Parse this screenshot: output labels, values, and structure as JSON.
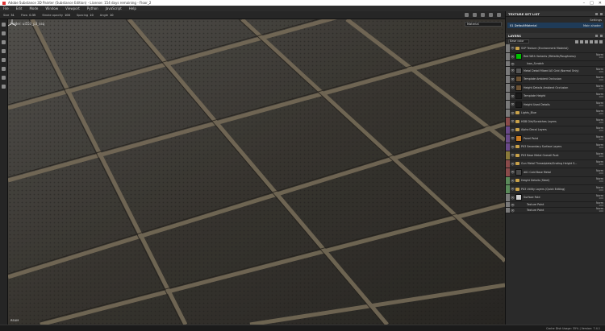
{
  "titlebar": {
    "text": "Adobe Substance 3D Painter (Substance Edition) - License: 154 days remaining - Floor_2"
  },
  "menubar": [
    "File",
    "Edit",
    "Mode",
    "Window",
    "Viewport",
    "Python",
    "JavaScript",
    "Help"
  ],
  "toolbar": {
    "items": [
      {
        "label": "Size",
        "value": "31"
      },
      {
        "label": "Flow",
        "value": "0.35"
      },
      {
        "label": "Stroke opacity",
        "value": "100"
      },
      {
        "label": "Spacing",
        "value": "10"
      },
      {
        "label": "Angle",
        "value": "10"
      }
    ]
  },
  "viewport": {
    "label": "Folder: ui553_p3_ssq",
    "material_select": "Material",
    "bottom_label": "REAM"
  },
  "statusbar": {
    "text": "Cache Disk Usage: 35% | Version: 7.4.1"
  },
  "texture_set_list": {
    "title": "TEXTURE SET LIST",
    "settings_label": "Settings",
    "set_name": "01 DefaultMaterial",
    "shader": "Main shader"
  },
  "layers": {
    "title": "LAYERS",
    "blend_select": "Base color",
    "items": [
      {
        "name": "SVP Texture (Environment Material)",
        "kind": "folder",
        "color": "#7a7a7a",
        "blend": "",
        "opacity": ""
      },
      {
        "name": "Red With Variants (Metallic/Roughness)",
        "kind": "fill",
        "color": "#7a7a7a",
        "thumb": "#00c000",
        "blend": "Norm",
        "opacity": "100"
      },
      {
        "name": "Ivan_Scratch",
        "kind": "effect",
        "color": "#7a7a7a",
        "blend": "",
        "opacity": ""
      },
      {
        "name": "Metal Detail Mixed AO Grid (Normal Only)",
        "kind": "fill",
        "color": "#7a7a7a",
        "thumb": "#555555",
        "blend": "Norm",
        "opacity": "100"
      },
      {
        "name": "Template Ambient Occlusion",
        "kind": "fill",
        "color": "#7a7a7a",
        "thumb": "#6b5234",
        "blend": "Norm",
        "opacity": "100"
      },
      {
        "name": "Height Details Ambient Occlusion",
        "kind": "fill",
        "color": "#7a7a7a",
        "thumb": "#6b5234",
        "blend": "Norm",
        "opacity": "100"
      },
      {
        "name": "Template Height",
        "kind": "fill",
        "color": "#7a7a7a",
        "thumb": "#1a1a1a",
        "blend": "Norm",
        "opacity": "100"
      },
      {
        "name": "Height Used Details",
        "kind": "fill",
        "color": "#7a7a7a",
        "thumb": "#1a1a1a",
        "blend": "Norm",
        "opacity": "100"
      },
      {
        "name": "Lights_Blue",
        "kind": "folder",
        "color": "#7a7a7a",
        "blend": "Norm",
        "opacity": "100"
      },
      {
        "name": "HDB Dirt/Scratches Layers",
        "kind": "folder",
        "color": "#8a4a4a",
        "blend": "Norm",
        "opacity": "100"
      },
      {
        "name": "Alpha Decal Layers",
        "kind": "folder",
        "color": "#6a4a8a",
        "blend": "Norm",
        "opacity": "100"
      },
      {
        "name": "Panel Paint",
        "kind": "fill",
        "color": "#6a4a8a",
        "thumb": "#c87a20",
        "blend": "Norm",
        "opacity": "100"
      },
      {
        "name": "P03 Secondary Surface Layers",
        "kind": "folder",
        "color": "#6a4a8a",
        "blend": "Norm",
        "opacity": "100"
      },
      {
        "name": "P03 Base Metal Overall Rust",
        "kind": "folder",
        "color": "#8a7a3a",
        "blend": "Norm",
        "opacity": "100"
      },
      {
        "name": "Gun Metal Threadplate/Grating Height S...",
        "kind": "folder",
        "color": "#8a4a4a",
        "blend": "Norm",
        "opacity": "100"
      },
      {
        "name": "d01 Cold Base Metal",
        "kind": "fill",
        "color": "#8a4a4a",
        "thumb": "#4a4a4a",
        "blend": "Norm",
        "opacity": "100"
      },
      {
        "name": "Height Details (Steel)",
        "kind": "folder",
        "color": "#5a8a5a",
        "blend": "Norm",
        "opacity": "100"
      },
      {
        "name": "P03 Utility Layers (Quick Editing)",
        "kind": "folder",
        "color": "#5a8a5a",
        "blend": "Norm",
        "opacity": "100"
      },
      {
        "name": "Surface Fold",
        "kind": "fill",
        "color": "#7a7a7a",
        "thumb": "#d0d0d0",
        "blend": "Norm",
        "opacity": "100"
      },
      {
        "name": "Texture Paint",
        "kind": "effect",
        "color": "#7a7a7a",
        "blend": "Norm",
        "opacity": "100"
      },
      {
        "name": "Texture Paint",
        "kind": "effect",
        "color": "#7a7a7a",
        "blend": "Norm",
        "opacity": "100"
      }
    ]
  },
  "icons": {
    "minimize": "minimize-icon",
    "maximize": "maximize-icon",
    "close": "close-icon"
  }
}
